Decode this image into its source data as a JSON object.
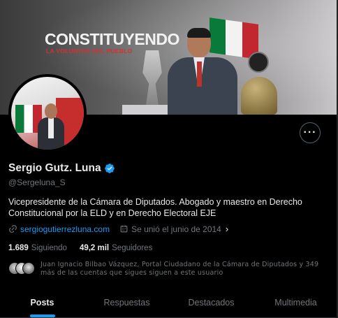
{
  "banner": {
    "title": "CONSTITUYENDO",
    "subtitle": "LA VOLUNTAD DEL PUEBLO"
  },
  "profile": {
    "name": "Sergio Gutz. Luna",
    "handle": "@Sergeluna_S",
    "verified": true,
    "bio": "Vicepresidente de la Cámara de Diputados. Abogado y maestro en Derecho Constitucional por la ELD y en Derecho Electoral EJE",
    "website": "sergiogutierrezluna.com",
    "joined": "Se unió el junio de 2014"
  },
  "counts": {
    "following_value": "1.689",
    "following_label": "Siguiendo",
    "followers_value": "49,2 mil",
    "followers_label": "Seguidores"
  },
  "followers_you_know": "Juan Ignacio Bilbao Vázquez, Portal Ciudadano de la Cámara de Diputados y 349 más de las cuentas que sigues siguen a este usuario",
  "more_button": "···",
  "tabs": [
    {
      "label": "Posts",
      "active": true
    },
    {
      "label": "Respuestas",
      "active": false
    },
    {
      "label": "Destacados",
      "active": false
    },
    {
      "label": "Multimedia",
      "active": false
    }
  ],
  "colors": {
    "accent": "#1d9bf0",
    "background": "#000000",
    "muted_text": "#71767b",
    "primary_text": "#e7e9ea"
  },
  "icons": {
    "verified": "verified-badge-icon",
    "link": "link-icon",
    "calendar": "calendar-icon",
    "chevron": "chevron-right-icon",
    "more": "more-horizontal-icon"
  }
}
